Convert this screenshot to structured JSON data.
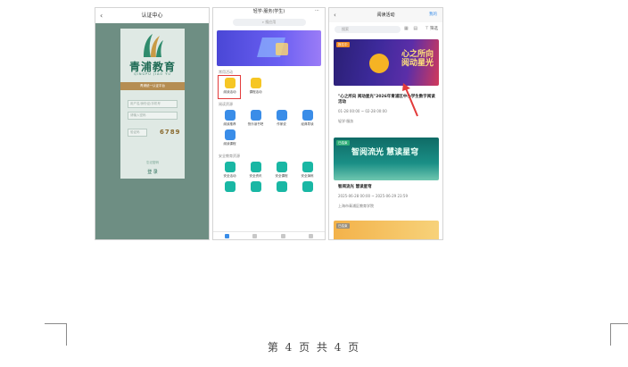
{
  "phone1": {
    "header": "认证中心",
    "brand": "青浦教育",
    "pinyin": "QINGPU JIAO YU",
    "band": "青浦统一认证平台",
    "username_placeholder": "用户名/身份证/手机号",
    "password_placeholder": "请输入密码",
    "captcha_placeholder": "验证码",
    "captcha_value": "6789",
    "link": "忘记密码",
    "login": "登 录"
  },
  "phone2": {
    "header": "轻学·服务(学生)",
    "search": "搜应用",
    "section1": "常用活动",
    "section1_items": [
      "阅读活动",
      "课程活动"
    ],
    "section2": "阅读资源",
    "section2_items": [
      "阅读推荐",
      "快乐读书吧",
      "作家说",
      "经典导读"
    ],
    "section2_extra": "阅读课程",
    "section3": "安全教育资源",
    "section3_items": [
      "安全活动",
      "安全资讯",
      "安全课程",
      "安全演练"
    ]
  },
  "phone3": {
    "header": "阅读活动",
    "mine": "我的",
    "search": "搜索",
    "filter": "筛选",
    "activities": [
      {
        "tag": "报名中",
        "banner": "心之所向 阅动星光",
        "title": "\"心之所向 阅动星光\"2026年青浦区中小学生数字阅读活动",
        "date": "01-28 00:00 ~ 02-28 00:00",
        "org": "轻学·服务"
      },
      {
        "tag": "已结束",
        "banner": "智阅流光 慧读星穹",
        "title": "智阅流光 慧读星穹",
        "date": "2025-06-28 00:00 ~ 2025-06-29 23:59",
        "org": "上海市青浦区教育学院"
      },
      {
        "tag": "已结束"
      }
    ]
  },
  "footer": {
    "page": "第 4 页 共 4 页"
  },
  "colors": {
    "highlight": "#e23b3b",
    "brand_green": "#1f6b55",
    "accent_blue": "#3a8de8"
  }
}
